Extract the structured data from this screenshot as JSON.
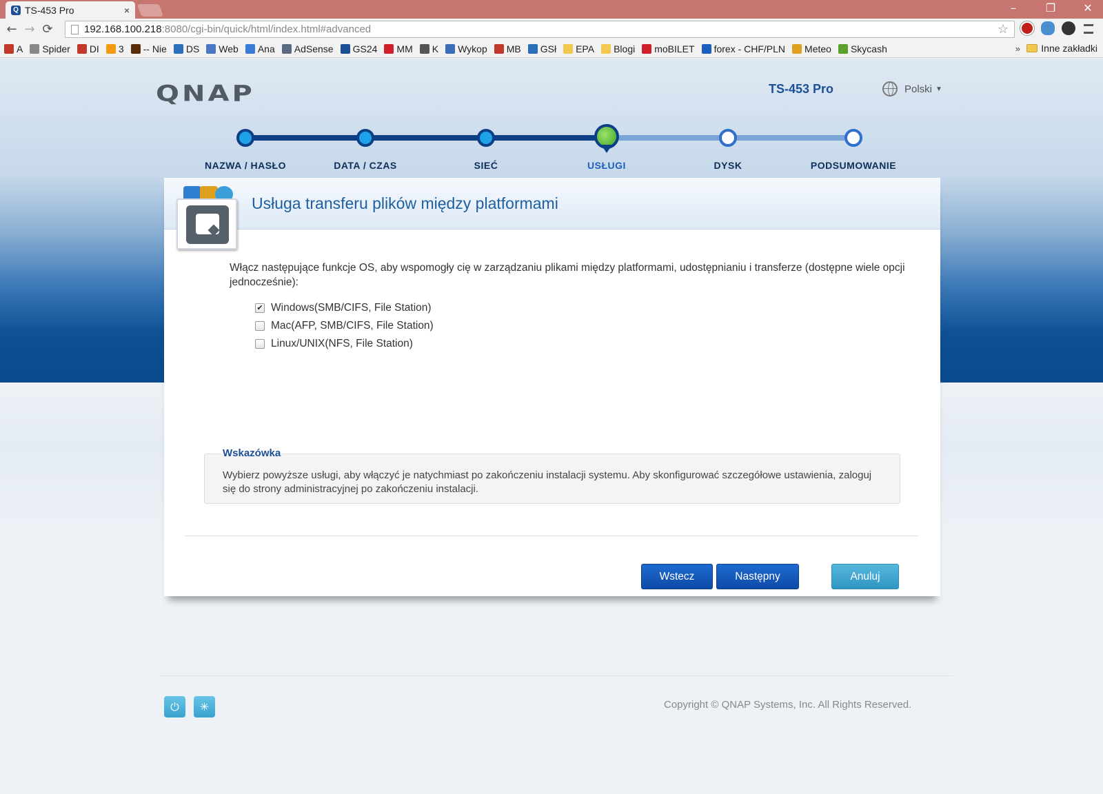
{
  "browser": {
    "tab_title": "TS-453 Pro",
    "tab_close": "×",
    "window_buttons": [
      "–",
      "❐",
      "✕"
    ],
    "url_host": "192.168.100.218",
    "url_path": ":8080/cgi-bin/quick/html/index.html#advanced",
    "nav": [
      "←",
      "→",
      "⟳"
    ],
    "star": "☆",
    "bookmarks": [
      {
        "label": "A",
        "color": "#c0392b"
      },
      {
        "label": "Spider",
        "color": "#888888"
      },
      {
        "label": "DI",
        "color": "#c0392b"
      },
      {
        "label": "3",
        "color": "#f39c12"
      },
      {
        "label": "-- Nie",
        "color": "#5a2d0c"
      },
      {
        "label": "DS",
        "color": "#2c6fbb"
      },
      {
        "label": "Web",
        "color": "#4a78c2"
      },
      {
        "label": "Ana",
        "color": "#3b7bd8"
      },
      {
        "label": "AdSense",
        "color": "#5a6a80"
      },
      {
        "label": "GS24",
        "color": "#1d4f97"
      },
      {
        "label": "MM",
        "color": "#d0202a"
      },
      {
        "label": "K",
        "color": "#555555"
      },
      {
        "label": "Wykop",
        "color": "#3a6fb5"
      },
      {
        "label": "MB",
        "color": "#c0392b"
      },
      {
        "label": "GSł",
        "color": "#2a6db8"
      },
      {
        "label": "EPA",
        "color": "#f3c84f"
      },
      {
        "label": "Blogi",
        "color": "#f3c84f"
      },
      {
        "label": "moBILET",
        "color": "#d0202a"
      },
      {
        "label": "forex - CHF/PLN",
        "color": "#1d5fbf"
      },
      {
        "label": "Meteo",
        "color": "#e0a020"
      },
      {
        "label": "Skycash",
        "color": "#5aa02c"
      }
    ],
    "bookmarks_more": "»",
    "other_bookmarks": "Inne zakładki"
  },
  "header": {
    "logo": "QNAP",
    "model": "TS-453 Pro",
    "language": "Polski"
  },
  "steps": [
    {
      "label": "NAZWA / HASŁO",
      "state": "done"
    },
    {
      "label": "DATA / CZAS",
      "state": "done"
    },
    {
      "label": "SIEĆ",
      "state": "done"
    },
    {
      "label": "USŁUGI",
      "state": "current"
    },
    {
      "label": "DYSK",
      "state": "todo"
    },
    {
      "label": "PODSUMOWANIE",
      "state": "todo"
    }
  ],
  "card": {
    "title": "Usługa transferu plików między platformami",
    "intro": "Włącz następujące funkcje OS, aby wspomogły cię w zarządzaniu plikami między platformami, udostępnianiu i transferze (dostępne wiele opcji jednocześnie):",
    "options": [
      {
        "label": "Windows(SMB/CIFS, File Station)",
        "checked": true
      },
      {
        "label": "Mac(AFP, SMB/CIFS, File Station)",
        "checked": false
      },
      {
        "label": "Linux/UNIX(NFS, File Station)",
        "checked": false
      }
    ],
    "hint_title": "Wskazówka",
    "hint_text": "Wybierz powyższe usługi, aby włączyć je natychmiast po zakończeniu instalacji systemu. Aby skonfigurować szczegółowe ustawienia, zaloguj się do strony administracyjnej po zakończeniu instalacji.",
    "buttons": {
      "back": "Wstecz",
      "next": "Następny",
      "cancel": "Anuluj"
    }
  },
  "footer": {
    "copyright": "Copyright © QNAP Systems, Inc. All Rights Reserved.",
    "power_icon": "⏻",
    "settings_icon": "✳"
  },
  "colors": {
    "brand_blue": "#1d4f97",
    "step_done": "#0d3f86",
    "step_current": "#3ea22a",
    "cancel_button": "#2f96c2"
  }
}
